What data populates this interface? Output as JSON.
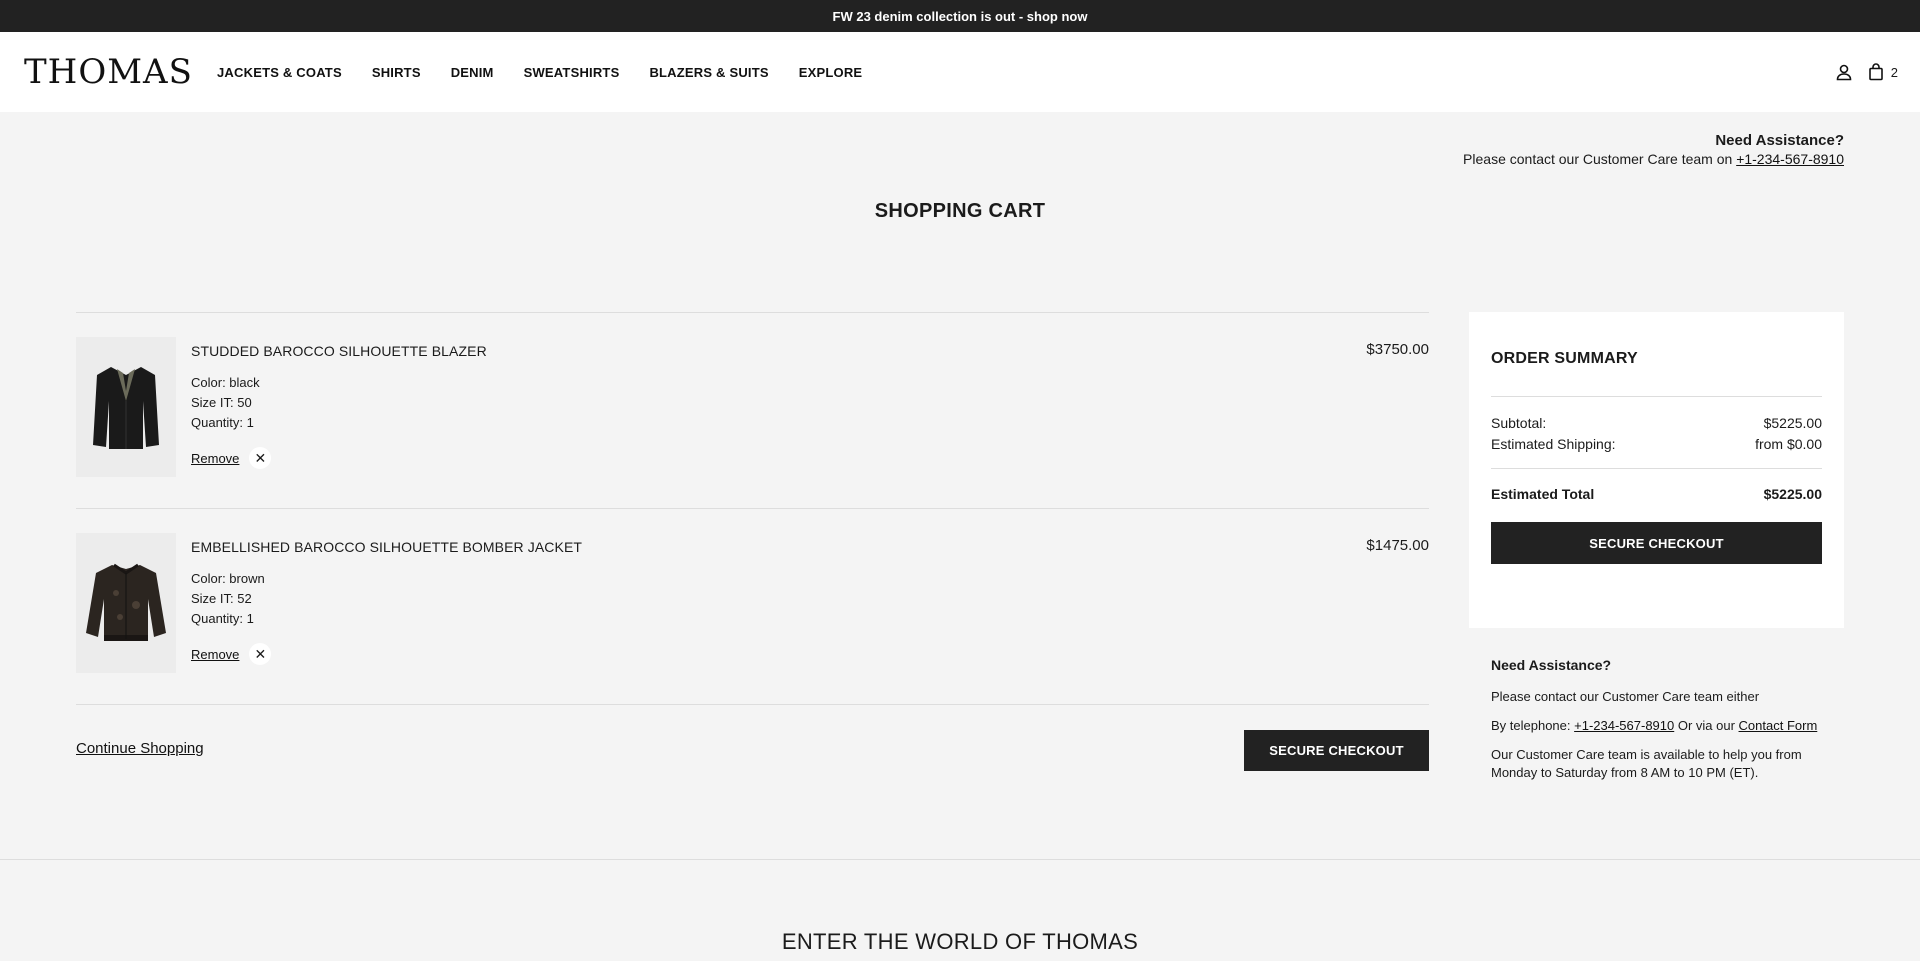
{
  "promo": {
    "text": "FW 23 denim collection is out - shop now"
  },
  "header": {
    "logo": "THOMAS",
    "nav": [
      "JACKETS & COATS",
      "SHIRTS",
      "DENIM",
      "SWEATSHIRTS",
      "BLAZERS & SUITS",
      "EXPLORE"
    ],
    "cart_count": "2"
  },
  "assist_top": {
    "title": "Need Assistance?",
    "text": "Please contact our Customer Care team on ",
    "phone": "+1-234-567-8910"
  },
  "page_title": "SHOPPING CART",
  "cart": {
    "items": [
      {
        "name": "STUDDED BAROCCO SILHOUETTE BLAZER",
        "color": "Color: black",
        "size": "Size IT: 50",
        "quantity": "Quantity: 1",
        "price": "$3750.00",
        "remove": "Remove"
      },
      {
        "name": "EMBELLISHED BAROCCO SILHOUETTE BOMBER JACKET",
        "color": "Color: brown",
        "size": "Size IT: 52",
        "quantity": "Quantity: 1",
        "price": "$1475.00",
        "remove": "Remove"
      }
    ],
    "continue": "Continue Shopping",
    "checkout": "SECURE CHECKOUT"
  },
  "summary": {
    "title": "ORDER SUMMARY",
    "subtotal_label": "Subtotal:",
    "subtotal": "$5225.00",
    "shipping_label": "Estimated Shipping:",
    "shipping": "from $0.00",
    "total_label": "Estimated Total",
    "total": "$5225.00",
    "checkout": "SECURE CHECKOUT"
  },
  "assist_side": {
    "title": "Need Assistance?",
    "line1": "Please contact our Customer Care team either",
    "tel_prefix": "By telephone: ",
    "phone": "+1-234-567-8910",
    "via": " Or via our ",
    "contact": "Contact Form",
    "hours": "Our Customer Care team is available to help you from Monday to Saturday from 8 AM to 10 PM (ET)."
  },
  "footer": {
    "title": "ENTER THE WORLD OF THOMAS"
  },
  "colors": {
    "dark": "#222222",
    "background": "#f4f4f4"
  }
}
